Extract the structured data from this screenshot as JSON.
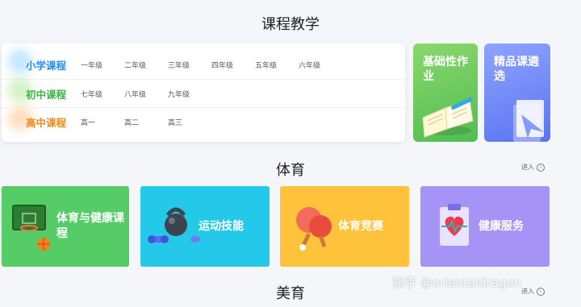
{
  "sections": {
    "courses_title": "课程教学",
    "sports_title": "体育",
    "arts_title": "美育"
  },
  "enter_label": "进入",
  "courses": [
    {
      "label": "小学课程",
      "color": "#2a8df0",
      "grades": [
        "一年级",
        "二年级",
        "三年级",
        "四年级",
        "五年级",
        "六年级"
      ]
    },
    {
      "label": "初中课程",
      "color": "#3cb44a",
      "grades": [
        "七年级",
        "八年级",
        "九年级"
      ]
    },
    {
      "label": "高中课程",
      "color": "#f08a1c",
      "grades": [
        "高一",
        "高二",
        "高三"
      ]
    }
  ],
  "tiles": {
    "basic_homework": "基础性作业",
    "featured_courses": "精品课遴选"
  },
  "sports": [
    {
      "label": "体育与健康课程",
      "icon": "basketball-icon"
    },
    {
      "label": "运动技能",
      "icon": "kettlebell-icon"
    },
    {
      "label": "体育竞赛",
      "icon": "ping-pong-icon"
    },
    {
      "label": "健康服务",
      "icon": "health-record-icon"
    }
  ],
  "watermark": "知乎 @orientaldragon"
}
